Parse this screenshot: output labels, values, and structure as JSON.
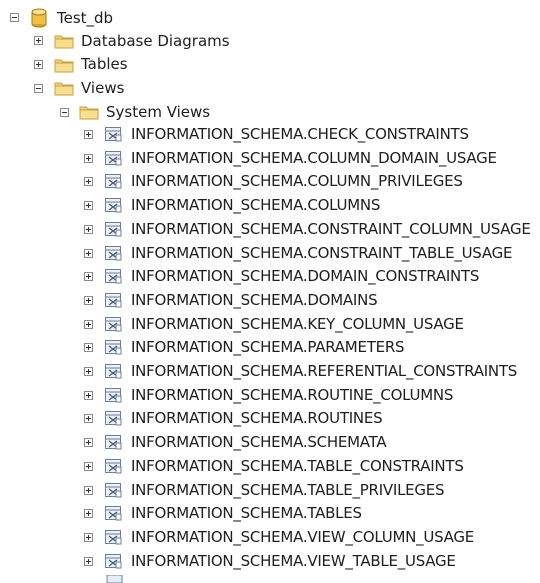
{
  "tree": {
    "database": {
      "label": "Test_db",
      "icon": "database-icon"
    },
    "database_diagrams": {
      "label": "Database Diagrams",
      "icon": "folder-icon"
    },
    "tables": {
      "label": "Tables",
      "icon": "folder-icon"
    },
    "views": {
      "label": "Views",
      "icon": "folder-icon"
    },
    "system_views": {
      "label": "System Views",
      "icon": "folder-icon",
      "items": [
        "INFORMATION_SCHEMA.CHECK_CONSTRAINTS",
        "INFORMATION_SCHEMA.COLUMN_DOMAIN_USAGE",
        "INFORMATION_SCHEMA.COLUMN_PRIVILEGES",
        "INFORMATION_SCHEMA.COLUMNS",
        "INFORMATION_SCHEMA.CONSTRAINT_COLUMN_USAGE",
        "INFORMATION_SCHEMA.CONSTRAINT_TABLE_USAGE",
        "INFORMATION_SCHEMA.DOMAIN_CONSTRAINTS",
        "INFORMATION_SCHEMA.DOMAINS",
        "INFORMATION_SCHEMA.KEY_COLUMN_USAGE",
        "INFORMATION_SCHEMA.PARAMETERS",
        "INFORMATION_SCHEMA.REFERENTIAL_CONSTRAINTS",
        "INFORMATION_SCHEMA.ROUTINE_COLUMNS",
        "INFORMATION_SCHEMA.ROUTINES",
        "INFORMATION_SCHEMA.SCHEMATA",
        "INFORMATION_SCHEMA.TABLE_CONSTRAINTS",
        "INFORMATION_SCHEMA.TABLE_PRIVILEGES",
        "INFORMATION_SCHEMA.TABLES",
        "INFORMATION_SCHEMA.VIEW_COLUMN_USAGE",
        "INFORMATION_SCHEMA.VIEW_TABLE_USAGE"
      ]
    }
  },
  "colors": {
    "folder_fill": "#f4d27a",
    "folder_edge": "#c9a23c",
    "database_fill": "#f0c040",
    "view_icon_edge": "#6a7f99"
  }
}
